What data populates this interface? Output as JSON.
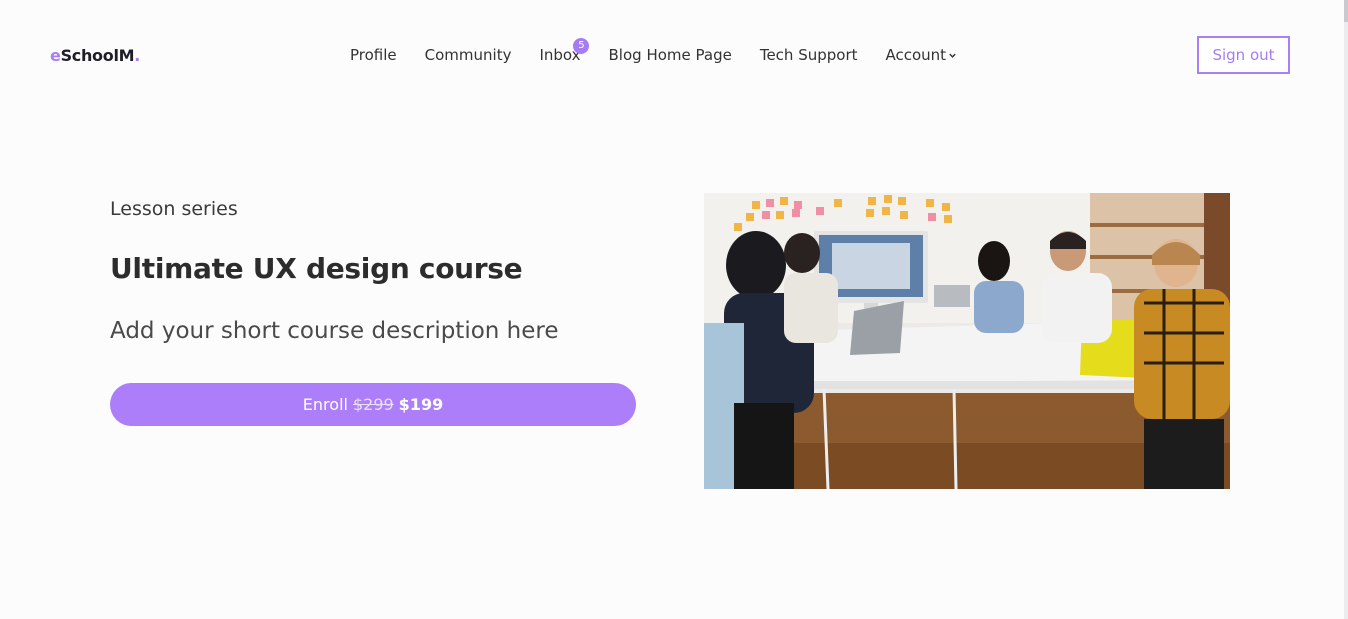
{
  "brand": {
    "name_accent_prefix": "e",
    "name": "SchoolM",
    "name_accent_suffix": "."
  },
  "nav": {
    "items": [
      {
        "label": "Profile"
      },
      {
        "label": "Community"
      },
      {
        "label": "Inbox",
        "badge": "5"
      },
      {
        "label": "Blog Home Page"
      },
      {
        "label": "Tech Support"
      },
      {
        "label": "Account",
        "icon": "chevron-down-icon"
      }
    ]
  },
  "header": {
    "signout_label": "Sign out"
  },
  "hero": {
    "eyebrow": "Lesson series",
    "title": "Ultimate UX design course",
    "description": "Add your short course description here",
    "enroll": {
      "label": "Enroll",
      "old_price": "$299",
      "new_price": "$199"
    },
    "image": {
      "subject": "team-meeting-photo"
    }
  },
  "colors": {
    "accent": "#ad7efa",
    "text": "#2c2c2c",
    "background": "#fcfcfd"
  }
}
